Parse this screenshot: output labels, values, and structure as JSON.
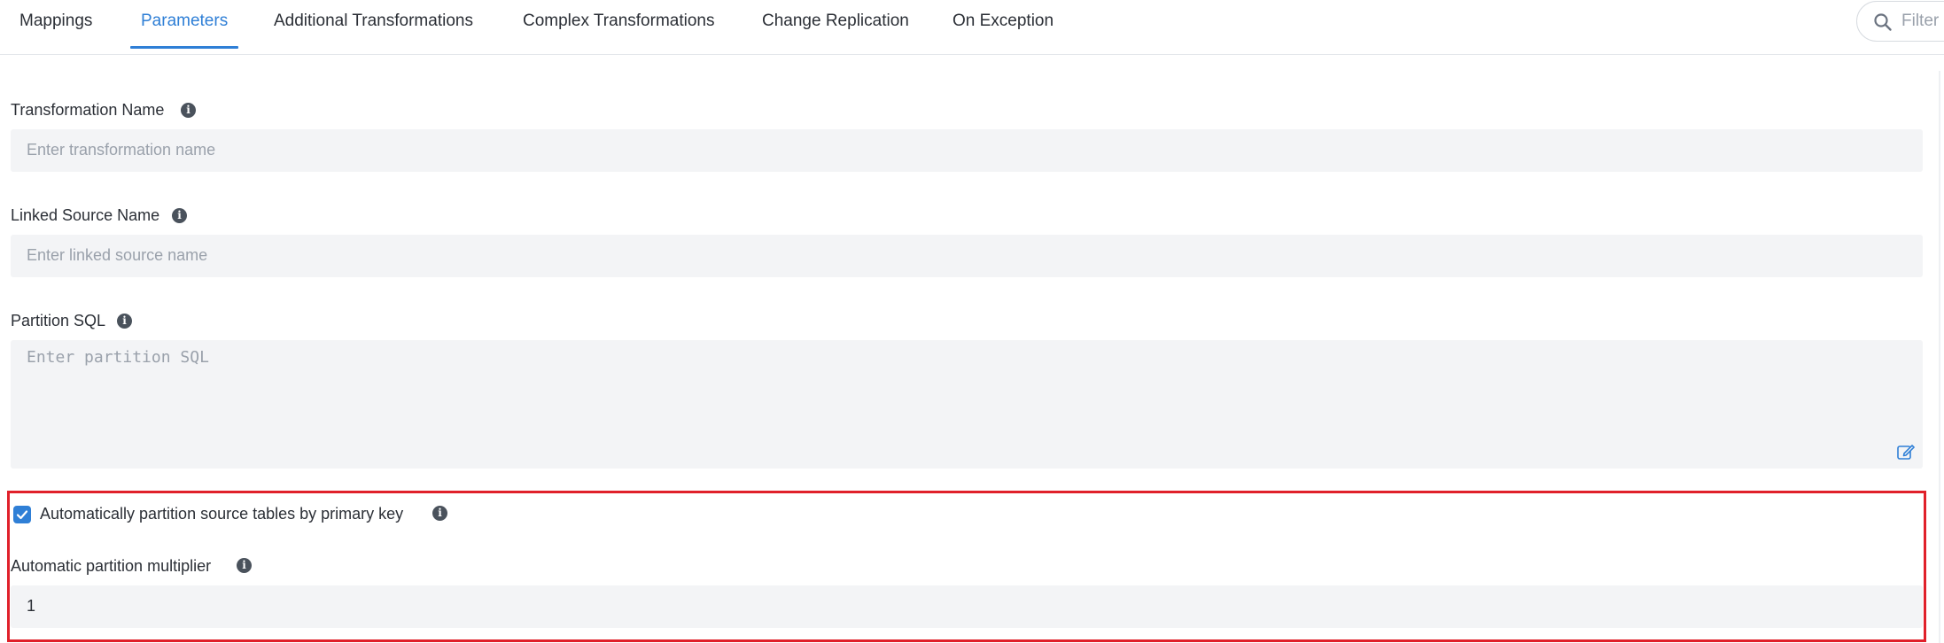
{
  "tabs": [
    {
      "label": "Mappings",
      "active": false
    },
    {
      "label": "Parameters",
      "active": true
    },
    {
      "label": "Additional Transformations",
      "active": false
    },
    {
      "label": "Complex Transformations",
      "active": false
    },
    {
      "label": "Change Replication",
      "active": false
    },
    {
      "label": "On Exception",
      "active": false
    }
  ],
  "filter": {
    "placeholder": "Filter",
    "icon": "search-icon"
  },
  "form": {
    "transformation_name": {
      "label": "Transformation Name",
      "placeholder": "Enter transformation name",
      "info_icon": "info-icon"
    },
    "linked_source_name": {
      "label": "Linked Source Name",
      "placeholder": "Enter linked source name",
      "info_icon": "info-icon"
    },
    "partition_sql": {
      "label": "Partition SQL",
      "placeholder": "Enter partition SQL",
      "info_icon": "info-icon",
      "edit_icon": "edit-icon"
    },
    "auto_partition": {
      "label": "Automatically partition source tables by primary key",
      "checked": true,
      "info_icon": "info-icon"
    },
    "partition_multiplier": {
      "label": "Automatic partition multiplier",
      "value": "1",
      "info_icon": "info-icon"
    }
  },
  "colors": {
    "accent": "#2f7fd6",
    "highlight_border": "#e0202a",
    "field_bg": "#f3f4f6"
  }
}
